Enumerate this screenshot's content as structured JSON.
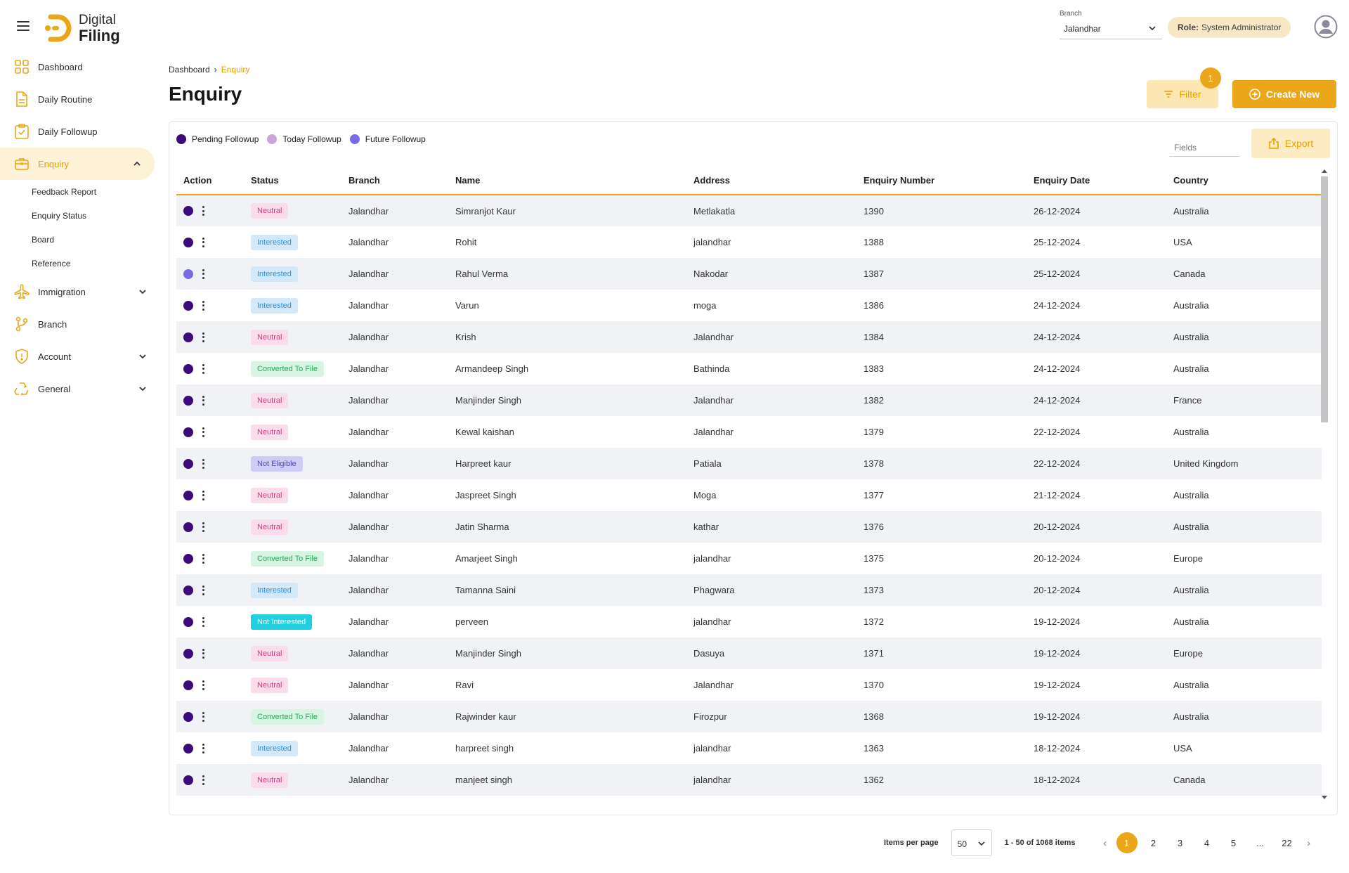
{
  "app": {
    "logo_line1": "Digital",
    "logo_line2": "Filing",
    "accent": "#eca61a"
  },
  "sidebar": {
    "items": [
      {
        "label": "Dashboard",
        "icon": "dashboard-icon"
      },
      {
        "label": "Daily Routine",
        "icon": "document-icon"
      },
      {
        "label": "Daily Followup",
        "icon": "clipboard-check-icon"
      },
      {
        "label": "Enquiry",
        "icon": "briefcase-icon",
        "active": true
      },
      {
        "label": "Immigration",
        "icon": "plane-icon"
      },
      {
        "label": "Branch",
        "icon": "git-branch-icon"
      },
      {
        "label": "Account",
        "icon": "shield-icon"
      },
      {
        "label": "General",
        "icon": "recycle-icon"
      }
    ],
    "enquiry_sub": [
      "Feedback Report",
      "Enquiry Status",
      "Board",
      "Reference"
    ]
  },
  "topbar": {
    "branch_label": "Branch",
    "branch_value": "Jalandhar",
    "role_key": "Role:",
    "role_value": "System Administrator"
  },
  "breadcrumb": {
    "root": "Dashboard",
    "sep": "›",
    "current": "Enquiry"
  },
  "page": {
    "title": "Enquiry",
    "filter_label": "Filter",
    "filter_count": "1",
    "create_label": "Create New",
    "fields_placeholder": "Fields",
    "export_label": "Export"
  },
  "legend": [
    {
      "label": "Pending Followup",
      "color": "#3c0a7a"
    },
    {
      "label": "Today Followup",
      "color": "#c8a6d8"
    },
    {
      "label": "Future Followup",
      "color": "#7a69e8"
    }
  ],
  "table": {
    "columns": [
      "Action",
      "Status",
      "Branch",
      "Name",
      "Address",
      "Enquiry Number",
      "Enquiry Date",
      "Country"
    ],
    "rows": [
      {
        "dot": "#3c0a7a",
        "status": "Neutral",
        "cls": "st-neutral",
        "branch": "Jalandhar",
        "name": "Simranjot Kaur",
        "address": "Metlakatla",
        "number": "1390",
        "date": "26-12-2024",
        "country": "Australia"
      },
      {
        "dot": "#3c0a7a",
        "status": "Interested",
        "cls": "st-interested",
        "branch": "Jalandhar",
        "name": "Rohit",
        "address": "jalandhar",
        "number": "1388",
        "date": "25-12-2024",
        "country": "USA"
      },
      {
        "dot": "#7a69e8",
        "status": "Interested",
        "cls": "st-interested",
        "branch": "Jalandhar",
        "name": "Rahul Verma",
        "address": "Nakodar",
        "number": "1387",
        "date": "25-12-2024",
        "country": "Canada"
      },
      {
        "dot": "#3c0a7a",
        "status": "Interested",
        "cls": "st-interested",
        "branch": "Jalandhar",
        "name": "Varun",
        "address": "moga",
        "number": "1386",
        "date": "24-12-2024",
        "country": "Australia"
      },
      {
        "dot": "#3c0a7a",
        "status": "Neutral",
        "cls": "st-neutral",
        "branch": "Jalandhar",
        "name": "Krish",
        "address": "Jalandhar",
        "number": "1384",
        "date": "24-12-2024",
        "country": "Australia"
      },
      {
        "dot": "#3c0a7a",
        "status": "Converted To File",
        "cls": "st-converted",
        "branch": "Jalandhar",
        "name": "Armandeep Singh",
        "address": "Bathinda",
        "number": "1383",
        "date": "24-12-2024",
        "country": "Australia"
      },
      {
        "dot": "#3c0a7a",
        "status": "Neutral",
        "cls": "st-neutral",
        "branch": "Jalandhar",
        "name": "Manjinder Singh",
        "address": "Jalandhar",
        "number": "1382",
        "date": "24-12-2024",
        "country": "France"
      },
      {
        "dot": "#3c0a7a",
        "status": "Neutral",
        "cls": "st-neutral",
        "branch": "Jalandhar",
        "name": "Kewal kaishan",
        "address": "Jalandhar",
        "number": "1379",
        "date": "22-12-2024",
        "country": "Australia"
      },
      {
        "dot": "#3c0a7a",
        "status": "Not Eligible",
        "cls": "st-noteligible",
        "branch": "Jalandhar",
        "name": "Harpreet kaur",
        "address": "Patiala",
        "number": "1378",
        "date": "22-12-2024",
        "country": "United Kingdom"
      },
      {
        "dot": "#3c0a7a",
        "status": "Neutral",
        "cls": "st-neutral",
        "branch": "Jalandhar",
        "name": "Jaspreet Singh",
        "address": "Moga",
        "number": "1377",
        "date": "21-12-2024",
        "country": "Australia"
      },
      {
        "dot": "#3c0a7a",
        "status": "Neutral",
        "cls": "st-neutral",
        "branch": "Jalandhar",
        "name": "Jatin Sharma",
        "address": "kathar",
        "number": "1376",
        "date": "20-12-2024",
        "country": "Australia"
      },
      {
        "dot": "#3c0a7a",
        "status": "Converted To File",
        "cls": "st-converted",
        "branch": "Jalandhar",
        "name": "Amarjeet Singh",
        "address": "jalandhar",
        "number": "1375",
        "date": "20-12-2024",
        "country": "Europe"
      },
      {
        "dot": "#3c0a7a",
        "status": "Interested",
        "cls": "st-interested",
        "branch": "Jalandhar",
        "name": "Tamanna Saini",
        "address": "Phagwara",
        "number": "1373",
        "date": "20-12-2024",
        "country": "Australia"
      },
      {
        "dot": "#3c0a7a",
        "status": "Not Interested",
        "cls": "st-notinterested",
        "branch": "Jalandhar",
        "name": "perveen",
        "address": "jalandhar",
        "number": "1372",
        "date": "19-12-2024",
        "country": "Australia"
      },
      {
        "dot": "#3c0a7a",
        "status": "Neutral",
        "cls": "st-neutral",
        "branch": "Jalandhar",
        "name": "Manjinder Singh",
        "address": "Dasuya",
        "number": "1371",
        "date": "19-12-2024",
        "country": "Europe"
      },
      {
        "dot": "#3c0a7a",
        "status": "Neutral",
        "cls": "st-neutral",
        "branch": "Jalandhar",
        "name": "Ravi",
        "address": "Jalandhar",
        "number": "1370",
        "date": "19-12-2024",
        "country": "Australia"
      },
      {
        "dot": "#3c0a7a",
        "status": "Converted To File",
        "cls": "st-converted",
        "branch": "Jalandhar",
        "name": "Rajwinder kaur",
        "address": "Firozpur",
        "number": "1368",
        "date": "19-12-2024",
        "country": "Australia"
      },
      {
        "dot": "#3c0a7a",
        "status": "Interested",
        "cls": "st-interested",
        "branch": "Jalandhar",
        "name": "harpreet singh",
        "address": "jalandhar",
        "number": "1363",
        "date": "18-12-2024",
        "country": "USA"
      },
      {
        "dot": "#3c0a7a",
        "status": "Neutral",
        "cls": "st-neutral",
        "branch": "Jalandhar",
        "name": "manjeet singh",
        "address": "jalandhar",
        "number": "1362",
        "date": "18-12-2024",
        "country": "Canada"
      }
    ]
  },
  "pagination": {
    "items_per_page_label": "Items per page",
    "per_page": "50",
    "range": "1 - 50 of 1068 items",
    "prev": "‹",
    "next": "›",
    "pages": [
      "1",
      "2",
      "3",
      "4",
      "5",
      "...",
      "22"
    ],
    "active": "1"
  }
}
